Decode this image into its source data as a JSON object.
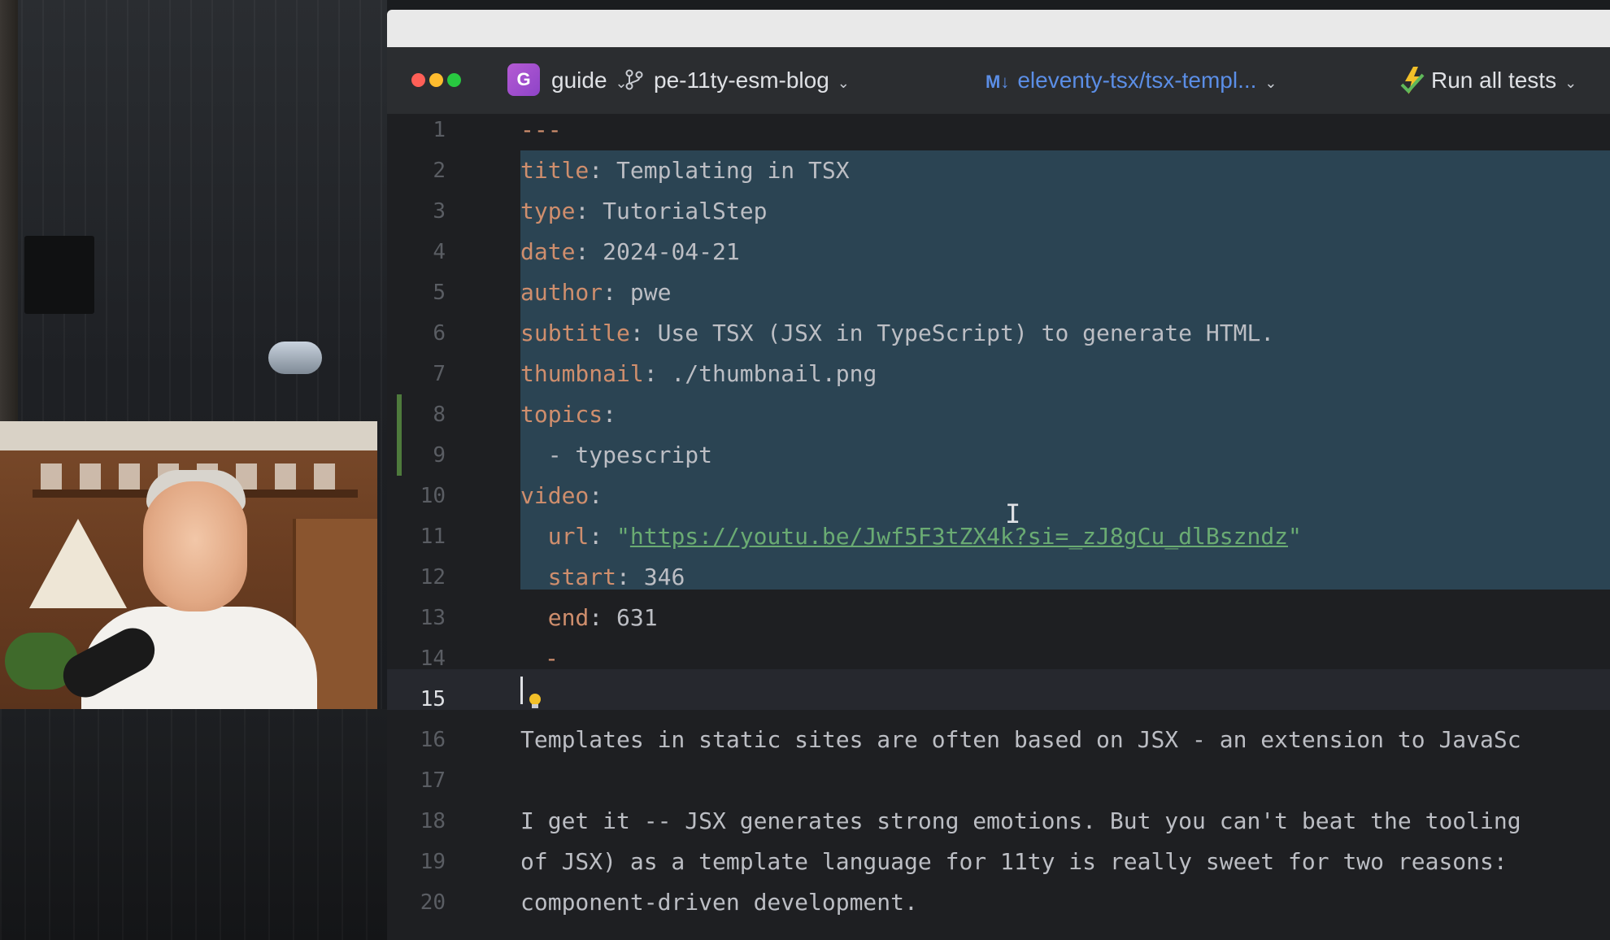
{
  "toolbar": {
    "project_initial": "G",
    "project_name": "guide",
    "branch_name": "pe-11ty-esm-blog",
    "file_icon": "M↓",
    "file_tab": "eleventy-tsx/tsx-templ...",
    "run_label": "Run all tests"
  },
  "editor": {
    "lines": [
      {
        "n": "1",
        "key": "---",
        "val": ""
      },
      {
        "n": "2",
        "key": "title",
        "val": ": Templating in TSX"
      },
      {
        "n": "3",
        "key": "type",
        "val": ": TutorialStep"
      },
      {
        "n": "4",
        "key": "date",
        "val": ": 2024-04-21"
      },
      {
        "n": "5",
        "key": "author",
        "val": ": pwe"
      },
      {
        "n": "6",
        "key": "subtitle",
        "val": ": Use TSX (JSX in TypeScript) to generate HTML."
      },
      {
        "n": "7",
        "key": "thumbnail",
        "val": ": ./thumbnail.png"
      },
      {
        "n": "8",
        "key": "topics",
        "val": ":"
      },
      {
        "n": "9",
        "key": "",
        "val": "  - typescript"
      },
      {
        "n": "10",
        "key": "video",
        "val": ":"
      },
      {
        "n": "11",
        "key": "  url",
        "val": ": ",
        "quote_open": "\"",
        "url": "https://youtu.be/Jwf5F3tZX4k?si=_zJ8gCu_dlBszndz",
        "quote_close": "\""
      },
      {
        "n": "12",
        "key": "  start",
        "val": ": 346"
      },
      {
        "n": "13",
        "key": "  end",
        "val": ": 631"
      },
      {
        "n": "14",
        "key": "",
        "val": "-"
      },
      {
        "n": "15",
        "key": "",
        "val": ""
      },
      {
        "n": "16",
        "key": "",
        "val": "Templates in static sites are often based on JSX - an extension to JavaSc"
      },
      {
        "n": "17",
        "key": "",
        "val": ""
      },
      {
        "n": "18",
        "key": "",
        "val": "I get it -- JSX generates strong emotions. But you can't beat the tooling"
      },
      {
        "n": "19",
        "key": "",
        "val": "of JSX) as a template language for 11ty is really sweet for two reasons:"
      },
      {
        "n": "20",
        "key": "",
        "val": "component-driven development."
      }
    ],
    "current_line": "15"
  },
  "colors": {
    "key": "#cf8e6d",
    "string": "#6aab73",
    "text": "#bcbec4",
    "selection": "#2b4453",
    "toolbar_bg": "#2b2d30",
    "editor_bg": "#1e1f22"
  }
}
